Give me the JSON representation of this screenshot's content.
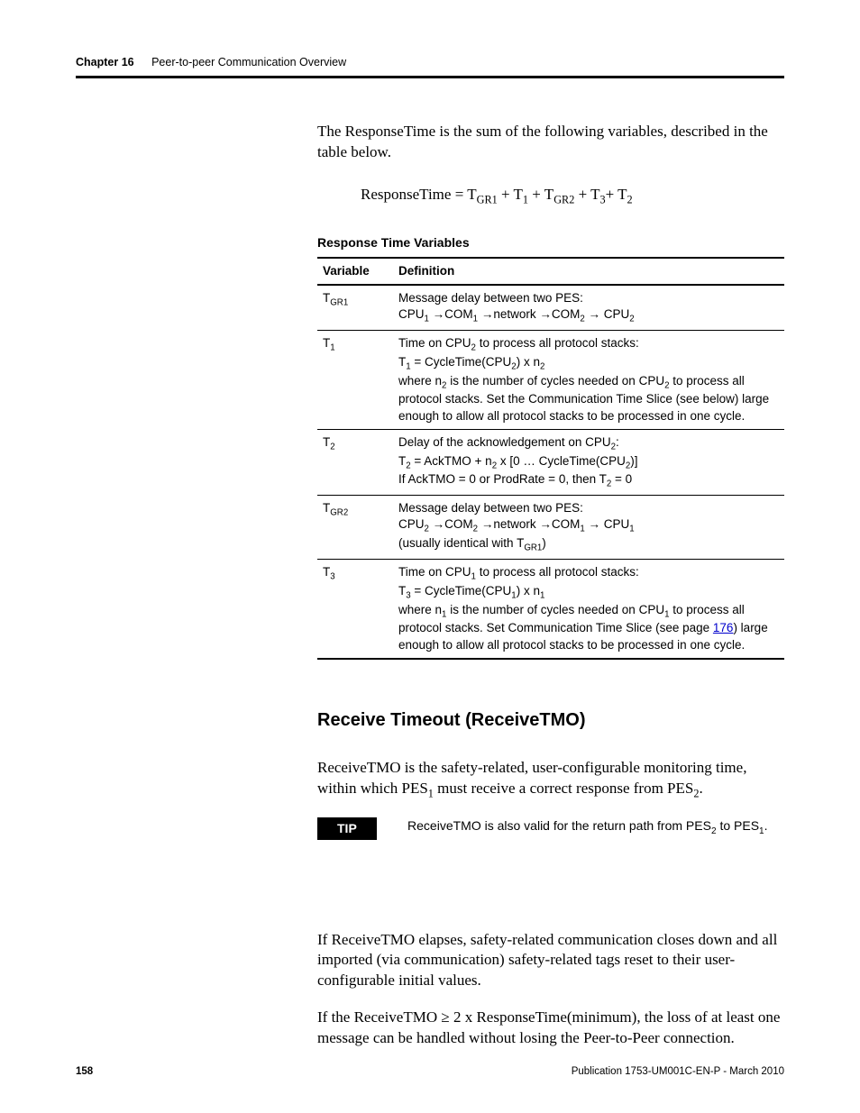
{
  "header": {
    "chapter_label": "Chapter 16",
    "chapter_title": "Peer-to-peer Communication Overview"
  },
  "intro": {
    "p1": "The ResponseTime is the sum of the following variables, described in the table below."
  },
  "formula": {
    "lead": "ResponseTime = T",
    "s1": "GR1",
    "plus1": " + T",
    "s2": "1",
    "plus2": " + T",
    "s3": "GR2",
    "plus3": " + T",
    "s4": "3",
    "plus4": "+ T",
    "s5": "2"
  },
  "table": {
    "title": "Response Time Variables",
    "h1": "Variable",
    "h2": "Definition",
    "rows": [
      {
        "var_pre": "T",
        "var_sub": "GR1",
        "def_l1": "Message delay between two PES:",
        "def_l2a": "CPU",
        "def_l2a_s": "1",
        "def_l2b": " →COM",
        "def_l2b_s": "1",
        "def_l2c": " →network →COM",
        "def_l2c_s": "2",
        "def_l2d": " → CPU",
        "def_l2d_s": "2"
      },
      {
        "var_pre": "T",
        "var_sub": "1",
        "def_a1": "Time on CPU",
        "def_a1_s": "2",
        "def_a1b": " to process all protocol stacks:",
        "def_b1": "T",
        "def_b1_s": "1",
        "def_b2": " = CycleTime(CPU",
        "def_b2_s": "2",
        "def_b3": ") x n",
        "def_b3_s": "2",
        "def_c1": "where n",
        "def_c1_s": "2",
        "def_c2": " is the number of cycles needed on CPU",
        "def_c2_s": "2",
        "def_c3": " to process all protocol stacks. Set the Communication Time Slice (see below) large enough to allow all protocol stacks to be processed in one cycle."
      },
      {
        "var_pre": "T",
        "var_sub": "2",
        "def_a1": "Delay of the acknowledgement on CPU",
        "def_a1_s": "2",
        "def_a1b": ":",
        "def_b1": "T",
        "def_b1_s": "2",
        "def_b2": " = AckTMO + n",
        "def_b2_s": "2",
        "def_b3": " x [0 … CycleTime(CPU",
        "def_b3_s": "2",
        "def_b4": ")]",
        "def_c1": "If AckTMO = 0 or ProdRate = 0, then T",
        "def_c1_s": "2",
        "def_c2": " = 0"
      },
      {
        "var_pre": "T",
        "var_sub": "GR2",
        "def_l1": "Message delay between two PES:",
        "def_l2a": "CPU",
        "def_l2a_s": "2",
        "def_l2b": " →COM",
        "def_l2b_s": "2",
        "def_l2c": " →network →COM",
        "def_l2c_s": "1",
        "def_l2d": " → CPU",
        "def_l2d_s": "1",
        "def_l3a": "(usually identical with T",
        "def_l3a_s": "GR1",
        "def_l3b": ")"
      },
      {
        "var_pre": "T",
        "var_sub": "3",
        "def_a1": "Time on CPU",
        "def_a1_s": "1",
        "def_a1b": " to process all protocol stacks:",
        "def_b1": "T",
        "def_b1_s": "3",
        "def_b2": " = CycleTime(CPU",
        "def_b2_s": "1",
        "def_b3": ") x n",
        "def_b3_s": "1",
        "def_c1": "where n",
        "def_c1_s": "1",
        "def_c2": " is the number of cycles needed on CPU",
        "def_c2_s": "1",
        "def_c3a": " to process all protocol stacks. Set Communication Time Slice (see page ",
        "def_c3_link": "176",
        "def_c3b": ") large enough to allow all protocol stacks to be processed in one cycle."
      }
    ]
  },
  "section": {
    "heading": "Receive Timeout (ReceiveTMO)",
    "p1a": "ReceiveTMO is the safety-related, user-configurable monitoring time, within which PES",
    "p1a_s": "1",
    "p1b": " must receive a correct response from PES",
    "p1b_s": "2",
    "p1c": "."
  },
  "tip": {
    "label": "TIP",
    "text_a": "ReceiveTMO is also valid for the return path from PES",
    "text_a_s": "2",
    "text_b": " to PES",
    "text_b_s": "1",
    "text_c": "."
  },
  "after": {
    "p1": "If ReceiveTMO elapses, safety-related communication closes down and all imported (via communication) safety-related tags reset to their user-configurable initial values.",
    "p2": "If the ReceiveTMO ≥ 2 x ResponseTime(minimum), the loss of at least one message can be handled without losing the Peer-to-Peer connection."
  },
  "footer": {
    "page": "158",
    "pub": "Publication 1753-UM001C-EN-P - March 2010"
  }
}
